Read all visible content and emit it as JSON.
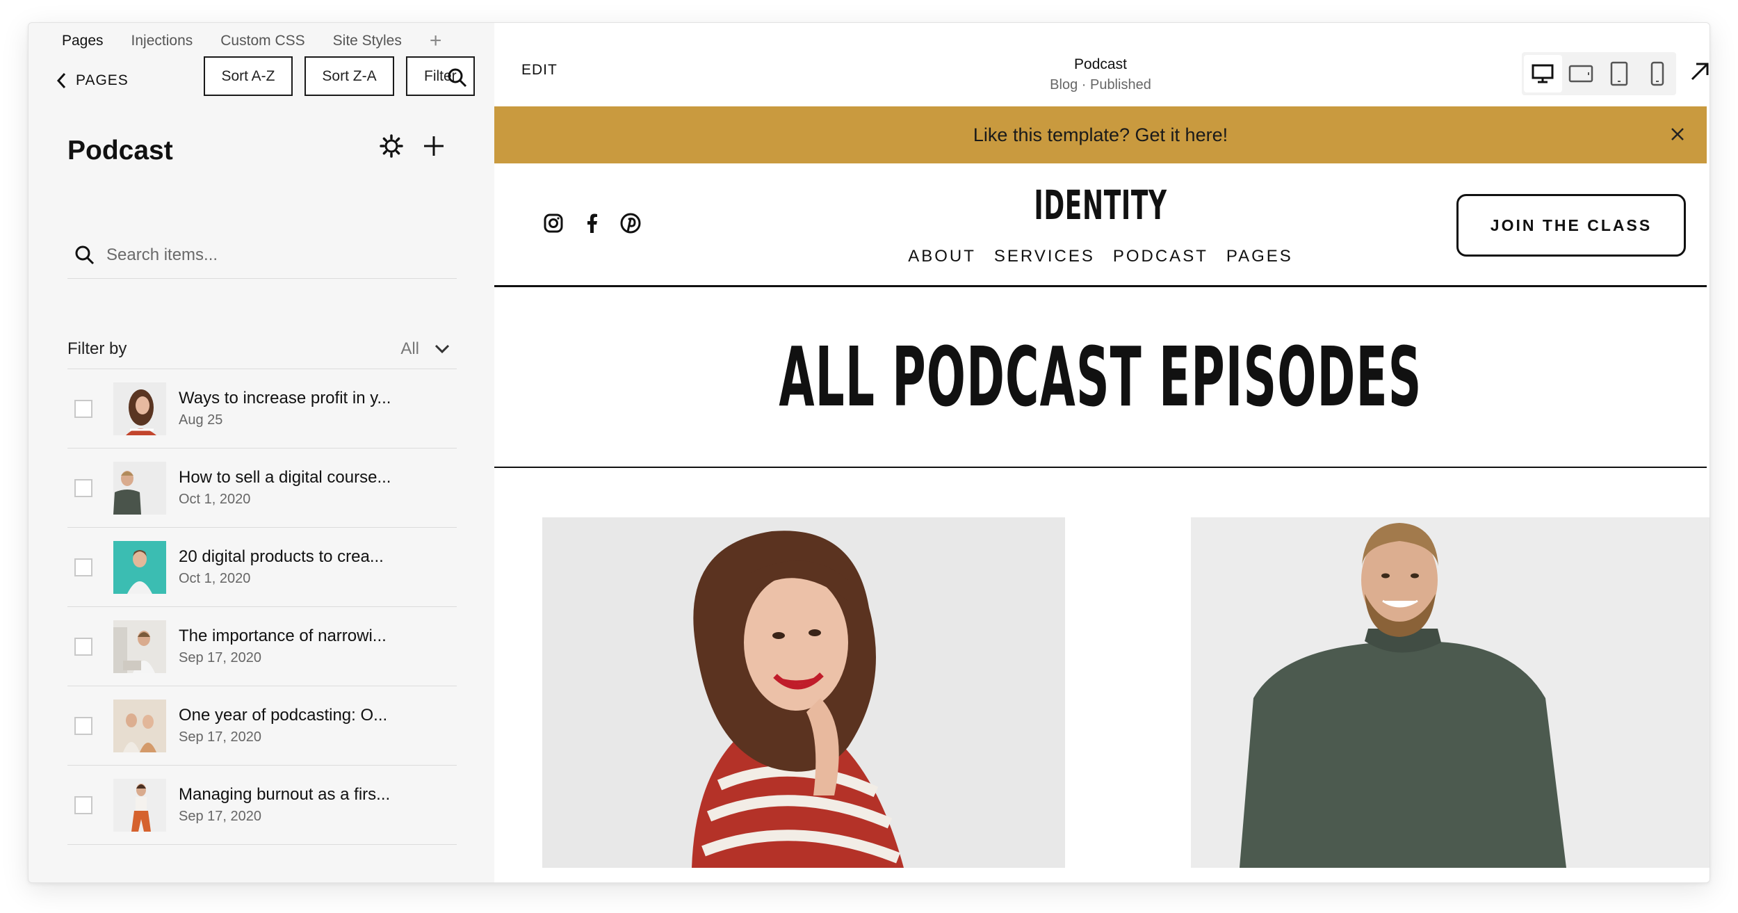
{
  "top_tabs": [
    "Pages",
    "Injections",
    "Custom CSS",
    "Site Styles"
  ],
  "back_label": "PAGES",
  "sort_buttons": {
    "az": "Sort A-Z",
    "za": "Sort Z-A",
    "filter": "Filter"
  },
  "panel": {
    "title": "Podcast",
    "search_placeholder": "Search items...",
    "filter_label": "Filter by",
    "filter_value": "All"
  },
  "items": [
    {
      "title": "Ways to increase profit in y...",
      "date": "Aug 25"
    },
    {
      "title": "How to sell a digital course...",
      "date": "Oct 1, 2020"
    },
    {
      "title": "20 digital products to crea...",
      "date": "Oct 1, 2020"
    },
    {
      "title": "The importance of narrowi...",
      "date": "Sep 17, 2020"
    },
    {
      "title": "One year of podcasting: O...",
      "date": "Sep 17, 2020"
    },
    {
      "title": "Managing burnout as a firs...",
      "date": "Sep 17, 2020"
    }
  ],
  "editor": {
    "edit_label": "EDIT",
    "page_title": "Podcast",
    "page_status": "Blog · Published"
  },
  "banner": {
    "text": "Like this template? Get it here!"
  },
  "site": {
    "logo": "IDENTITY",
    "nav": [
      "ABOUT",
      "SERVICES",
      "PODCAST",
      "PAGES"
    ],
    "cta": "JOIN THE CLASS",
    "heading": "ALL PODCAST EPISODES"
  },
  "colors": {
    "banner": "#c99a3f",
    "panel_bg": "#f6f6f6",
    "text": "#111111"
  },
  "icons": [
    "chevron-left-icon",
    "search-icon",
    "gear-icon",
    "plus-icon",
    "chevron-down-icon",
    "desktop-icon",
    "tablet-landscape-icon",
    "tablet-portrait-icon",
    "phone-icon",
    "expand-arrow-icon",
    "close-icon",
    "instagram-icon",
    "facebook-icon",
    "pinterest-icon"
  ]
}
